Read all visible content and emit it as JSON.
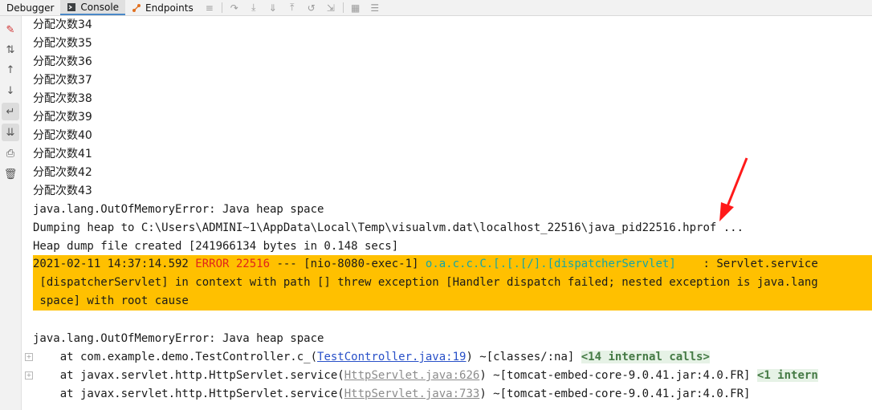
{
  "tabs": [
    {
      "label": "Debugger",
      "icon": "debugger-icon"
    },
    {
      "label": "Console",
      "icon": "console-icon"
    },
    {
      "label": "Endpoints",
      "icon": "endpoints-icon"
    }
  ],
  "alloc_lines": [
    "分配次数34",
    "分配次数35",
    "分配次数36",
    "分配次数37",
    "分配次数38",
    "分配次数39",
    "分配次数40",
    "分配次数41",
    "分配次数42",
    "分配次数43"
  ],
  "oom1": "java.lang.OutOfMemoryError: Java heap space",
  "dump_line": "Dumping heap to C:\\Users\\ADMINI~1\\AppData\\Local\\Temp\\visualvm.dat\\localhost_22516\\java_pid22516.hprof ...",
  "heap_line": "Heap dump file created [241966134 bytes in 0.148 secs]",
  "error_block": {
    "timestamp": "2021-02-11 14:37:14.592 ",
    "level": "ERROR 22516",
    "sep": " --- [nio-8080-exec-1] ",
    "logger": "o.a.c.c.C.[.[.[/].[dispatcherServlet]",
    "msg1": "    : Servlet.service",
    "line2": " [dispatcherServlet] in context with path [] threw exception [Handler dispatch failed; nested exception is java.lang",
    "line3": " space] with root cause"
  },
  "oom2": "java.lang.OutOfMemoryError: Java heap space",
  "stack": {
    "l1_prefix": "    at com.example.demo.TestController.c_(",
    "l1_link": "TestController.java:19",
    "l1_suffix": ") ~[classes/:na] ",
    "l1_folded": "<14 internal calls>",
    "l2_prefix": "    at javax.servlet.http.HttpServlet.service(",
    "l2_link": "HttpServlet.java:626",
    "l2_suffix": ") ~[tomcat-embed-core-9.0.41.jar:4.0.FR] ",
    "l2_folded": "<1 intern",
    "l3_prefix": "    at javax.servlet.http.HttpServlet.service(",
    "l3_link": "HttpServlet.java:733",
    "l3_suffix": ") ~[tomcat-embed-core-9.0.41.jar:4.0.FR]"
  },
  "colors": {
    "accent_tab": "#4a88c7",
    "error_bg": "#ffc000",
    "error_red": "#e0241b",
    "logger_cyan": "#14a6a6",
    "annotation_arrow": "#ff1a1a"
  }
}
